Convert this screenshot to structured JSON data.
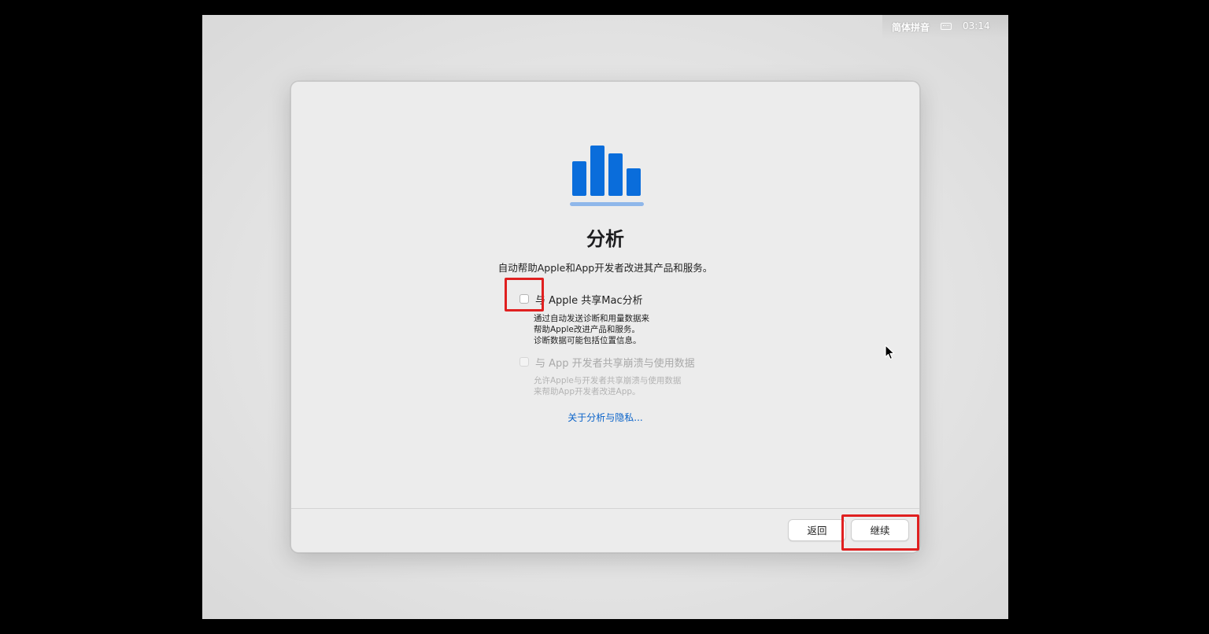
{
  "menubar": {
    "input_method": "简体拼音",
    "keyboard_icon": "keyboard-icon",
    "clock": "03:14"
  },
  "dialog": {
    "icon": "analytics-bars-icon",
    "title": "分析",
    "subtitle": "自动帮助Apple和App开发者改进其产品和服务。",
    "option_mac": {
      "label": "与 Apple 共享Mac分析",
      "checked": false,
      "enabled": true,
      "desc_line1": "通过自动发送诊断和用量数据来",
      "desc_line2": "帮助Apple改进产品和服务。",
      "desc_line3": "诊断数据可能包括位置信息。"
    },
    "option_dev": {
      "label": "与 App 开发者共享崩溃与使用数据",
      "checked": false,
      "enabled": false,
      "desc_line1": "允许Apple与开发者共享崩溃与使用数据",
      "desc_line2": "来帮助App开发者改进App。"
    },
    "privacy_link": "关于分析与隐私...",
    "back_label": "返回",
    "continue_label": "继续"
  },
  "colors": {
    "accent_blue": "#0a6ddb",
    "link_blue": "#0a63c9",
    "highlight_red": "#e02020"
  }
}
